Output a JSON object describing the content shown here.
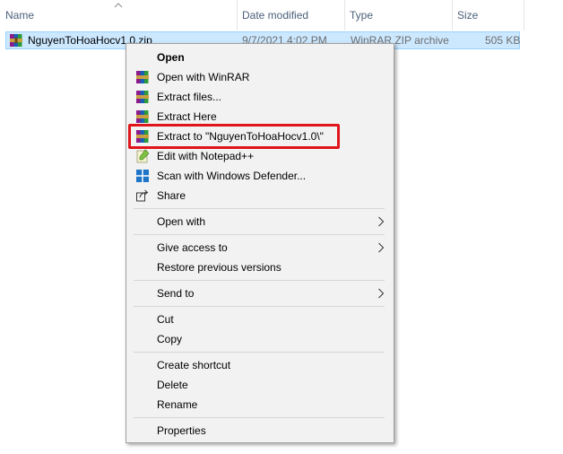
{
  "columns": {
    "name": "Name",
    "date_modified": "Date modified",
    "type": "Type",
    "size": "Size"
  },
  "file": {
    "name": "NguyenToHoaHocv1.0.zip",
    "date_modified": "9/7/2021 4:02 PM",
    "type": "WinRAR ZIP archive",
    "size": "505 KB",
    "icon": "winrar-archive-icon"
  },
  "context_menu": {
    "open": "Open",
    "open_with_winrar": "Open with WinRAR",
    "extract_files": "Extract files...",
    "extract_here": "Extract Here",
    "extract_to": "Extract to \"NguyenToHoaHocv1.0\\\"",
    "edit_notepad": "Edit with Notepad++",
    "scan_defender": "Scan with Windows Defender...",
    "share": "Share",
    "open_with": "Open with",
    "give_access": "Give access to",
    "restore_versions": "Restore previous versions",
    "send_to": "Send to",
    "cut": "Cut",
    "copy": "Copy",
    "create_shortcut": "Create shortcut",
    "delete": "Delete",
    "rename": "Rename",
    "properties": "Properties"
  },
  "colors": {
    "highlight": "#e0141b",
    "selection": "#cce8ff",
    "header_text": "#4c607a"
  }
}
